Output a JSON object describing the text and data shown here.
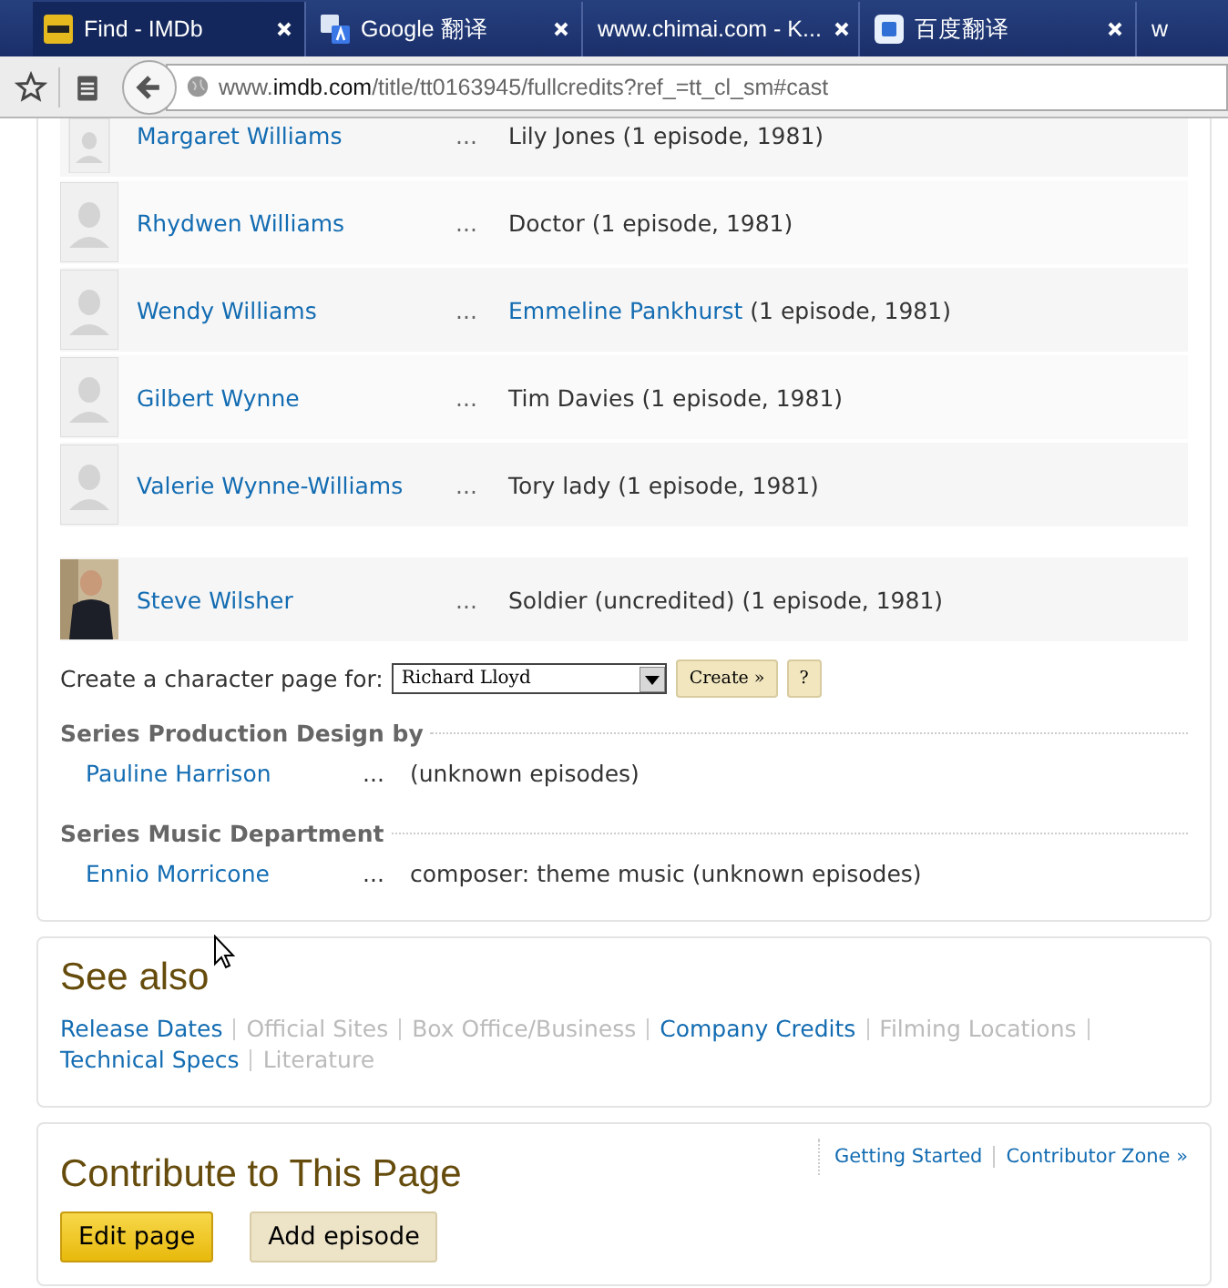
{
  "browser": {
    "tabs": [
      {
        "title": "Find - IMDb",
        "selected": true
      },
      {
        "title": "Google 翻译",
        "selected": false
      },
      {
        "title": "www.chimai.com - K...",
        "selected": false
      },
      {
        "title": "百度翻译",
        "selected": false
      },
      {
        "title": "w",
        "selected": false
      }
    ],
    "address": {
      "host_pre": "www.",
      "host": "imdb.com",
      "path": "/title/tt0163945/fullcredits?ref_=tt_cl_sm#cast"
    }
  },
  "cast": [
    {
      "name": "Margaret Williams",
      "kind": "placeholder",
      "separator": "...",
      "role": "Lily Jones",
      "role_is_link": false,
      "episodes": "(1 episode, 1981)"
    },
    {
      "name": "Rhydwen Williams",
      "kind": "placeholder",
      "separator": "...",
      "role": "Doctor",
      "role_is_link": false,
      "episodes": "(1 episode, 1981)"
    },
    {
      "name": "Wendy Williams",
      "kind": "placeholder",
      "separator": "...",
      "role": "Emmeline Pankhurst",
      "role_is_link": true,
      "episodes": "(1 episode, 1981)"
    },
    {
      "name": "Gilbert Wynne",
      "kind": "placeholder",
      "separator": "...",
      "role": "Tim Davies",
      "role_is_link": false,
      "episodes": "(1 episode, 1981)"
    },
    {
      "name": "Valerie Wynne-Williams",
      "kind": "placeholder",
      "separator": "...",
      "role": "Tory lady",
      "role_is_link": false,
      "episodes": "(1 episode, 1981)"
    }
  ],
  "uncredited_cast": [
    {
      "name": "Steve Wilsher",
      "separator": "...",
      "role": "Soldier (uncredited)",
      "role_is_link": false,
      "episodes": "(1 episode, 1981)"
    }
  ],
  "character_page": {
    "label": "Create a character page for:",
    "value": "Richard Lloyd",
    "create_button": "Create »",
    "help_button": "?"
  },
  "sections": [
    {
      "title": "Series Production Design by",
      "credits": [
        {
          "name": "Pauline Harrison",
          "separator": "...",
          "credit": "(unknown episodes)"
        }
      ]
    },
    {
      "title": "Series Music Department",
      "credits": [
        {
          "name": "Ennio Morricone",
          "separator": "...",
          "credit": "composer: theme music (unknown episodes)"
        }
      ]
    }
  ],
  "see_also": {
    "title": "See also",
    "links": [
      {
        "label": "Release Dates",
        "disabled": false
      },
      {
        "label": "Official Sites",
        "disabled": true
      },
      {
        "label": "Box Office/Business",
        "disabled": true
      },
      {
        "label": "Company Credits",
        "disabled": false
      },
      {
        "label": "Filming Locations",
        "disabled": true
      },
      {
        "label": "Technical Specs",
        "disabled": false
      },
      {
        "label": "Literature",
        "disabled": true
      }
    ]
  },
  "contribute": {
    "title": "Contribute to This Page",
    "links": [
      "Getting Started",
      "Contributor Zone »"
    ],
    "buttons": [
      {
        "label": "Edit page",
        "kind": "primary"
      },
      {
        "label": "Add episode",
        "kind": "secondary"
      }
    ]
  }
}
